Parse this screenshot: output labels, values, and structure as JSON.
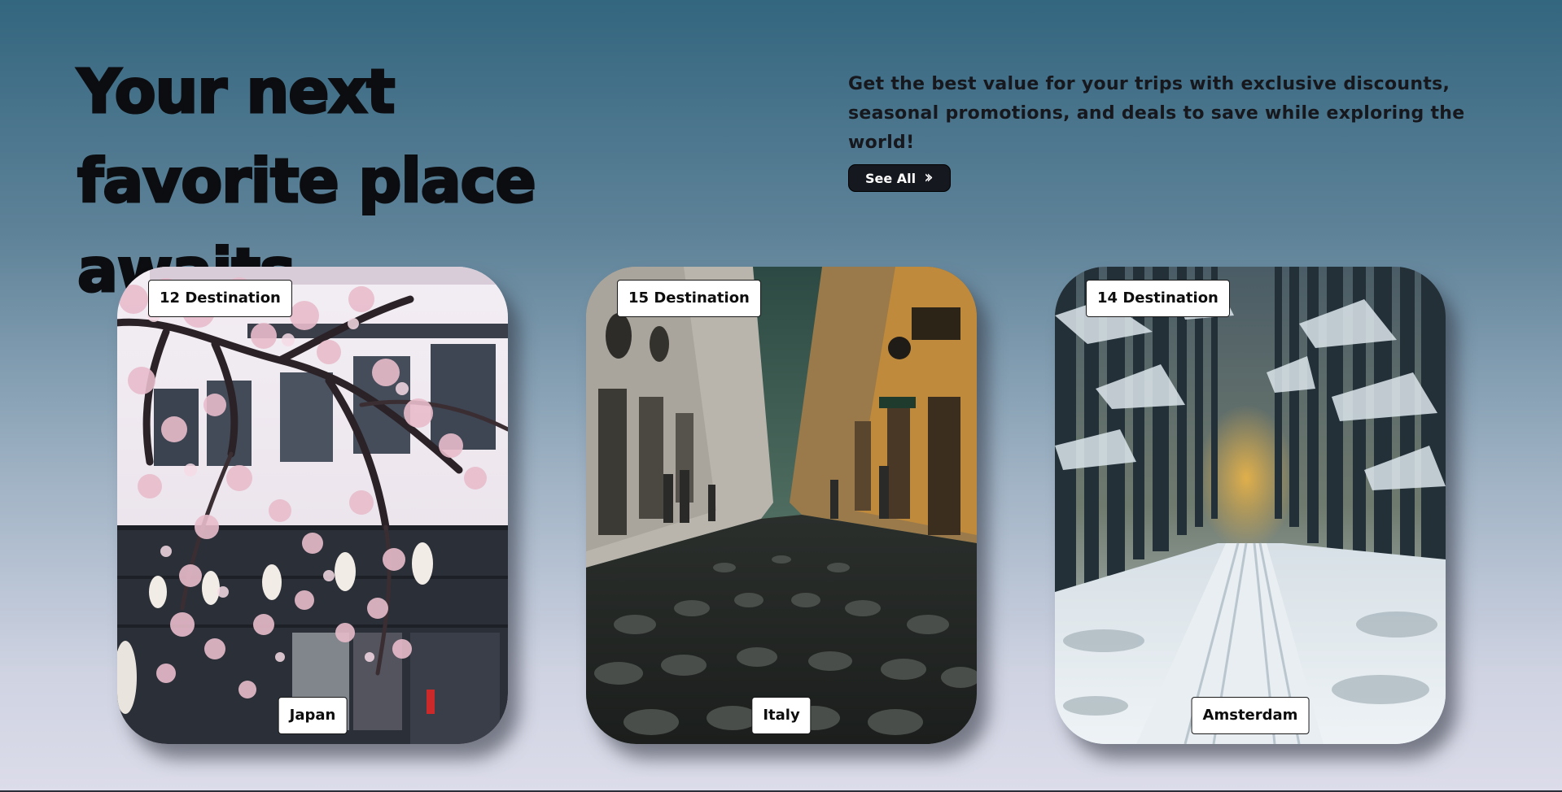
{
  "hero": {
    "headline": "Your next favorite place awaits",
    "description": "Get the best value for your trips with exclusive discounts, seasonal promotions, and deals to save while exploring the world!",
    "see_all_label": "See All",
    "see_all_icon": "double-chevron-right-icon"
  },
  "destinations": [
    {
      "count_label": "12 Destination",
      "name": "Japan",
      "image": "cherry-blossom-street"
    },
    {
      "count_label": "15 Destination",
      "name": "Italy",
      "image": "cobblestone-street"
    },
    {
      "count_label": "14 Destination",
      "name": "Amsterdam",
      "image": "snowy-forest-road"
    }
  ],
  "colors": {
    "background_top": "#33667f",
    "background_bottom": "#dcdcea",
    "button_bg": "#15181f",
    "badge_bg": "#ffffff"
  }
}
